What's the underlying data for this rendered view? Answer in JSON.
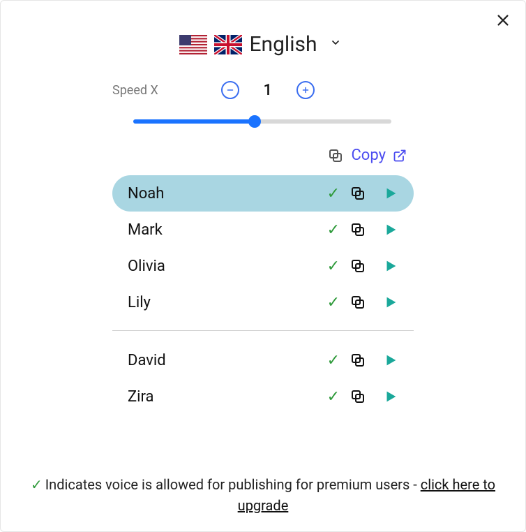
{
  "language": {
    "label": "English"
  },
  "speed": {
    "label": "Speed X",
    "value": "1",
    "slider_percent": 47
  },
  "copy_bar": {
    "label": "Copy"
  },
  "voices_group1": [
    {
      "name": "Noah",
      "selected": true
    },
    {
      "name": "Mark",
      "selected": false
    },
    {
      "name": "Olivia",
      "selected": false
    },
    {
      "name": "Lily",
      "selected": false
    }
  ],
  "voices_group2": [
    {
      "name": "David",
      "selected": false
    },
    {
      "name": "Zira",
      "selected": false
    }
  ],
  "footer": {
    "text": "Indicates voice is allowed for publishing for premium users - ",
    "link": "click here to upgrade"
  }
}
